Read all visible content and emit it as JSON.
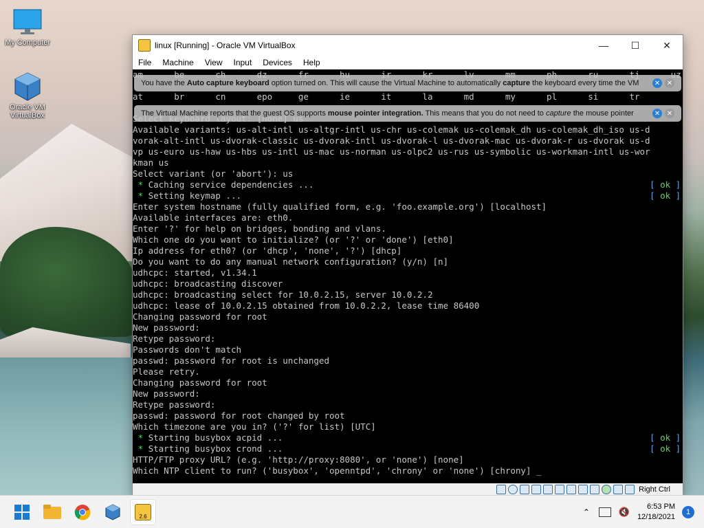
{
  "desktop": {
    "icons": [
      {
        "label": "My Computer"
      },
      {
        "label": "Oracle VM VirtualBox"
      }
    ]
  },
  "window": {
    "title": "linux [Running] - Oracle VM VirtualBox",
    "menu": [
      "File",
      "Machine",
      "View",
      "Input",
      "Devices",
      "Help"
    ],
    "banners": [
      {
        "pre": "You have the ",
        "b1": "Auto capture keyboard",
        "mid": " option turned on. This will cause the Virtual Machine to automatically ",
        "b2": "capture",
        "post": " the keyboard every time the VM"
      },
      {
        "pre": "The Virtual Machine reports that the guest OS supports ",
        "b1": "mouse pointer integration.",
        "mid": " This means that you do not need to ",
        "b2": "capture",
        "post": " the mouse pointer"
      }
    ],
    "terminal": [
      {
        "text": "am      be      ch      dz      fr      hu      ir      kr      lv      mm      ph      ru      tj      uz"
      },
      {
        "text": "                                                                                                        "
      },
      {
        "text": "at      br      cn      epo     ge      ie      it      la      md      my      pl      si      tr"
      },
      {
        "text": "                                                                                                        "
      },
      {
        "text": "Select keyboard layout: [none] us"
      },
      {
        "text": "Available variants: us-alt-intl us-altgr-intl us-chr us-colemak us-colemak_dh us-colemak_dh_iso us-d"
      },
      {
        "text": "vorak-alt-intl us-dvorak-classic us-dvorak-intl us-dvorak-l us-dvorak-mac us-dvorak-r us-dvorak us-d"
      },
      {
        "text": "vp us-euro us-haw us-hbs us-intl us-mac us-norman us-olpc2 us-rus us-symbolic us-workman-intl us-wor"
      },
      {
        "text": "kman us"
      },
      {
        "text": "Select variant (or 'abort'): us"
      },
      {
        "text": " * Caching service dependencies ...",
        "ok": true
      },
      {
        "text": " * Setting keymap ...",
        "ok": true
      },
      {
        "text": "Enter system hostname (fully qualified form, e.g. 'foo.example.org') [localhost]"
      },
      {
        "text": "Available interfaces are: eth0."
      },
      {
        "text": "Enter '?' for help on bridges, bonding and vlans."
      },
      {
        "text": "Which one do you want to initialize? (or '?' or 'done') [eth0]"
      },
      {
        "text": "Ip address for eth0? (or 'dhcp', 'none', '?') [dhcp]"
      },
      {
        "text": "Do you want to do any manual network configuration? (y/n) [n]"
      },
      {
        "text": "udhcpc: started, v1.34.1"
      },
      {
        "text": "udhcpc: broadcasting discover"
      },
      {
        "text": "udhcpc: broadcasting select for 10.0.2.15, server 10.0.2.2"
      },
      {
        "text": "udhcpc: lease of 10.0.2.15 obtained from 10.0.2.2, lease time 86400"
      },
      {
        "text": "Changing password for root"
      },
      {
        "text": "New password:"
      },
      {
        "text": "Retype password:"
      },
      {
        "text": "Passwords don't match"
      },
      {
        "text": "passwd: password for root is unchanged"
      },
      {
        "text": "Please retry."
      },
      {
        "text": "Changing password for root"
      },
      {
        "text": "New password:"
      },
      {
        "text": "Retype password:"
      },
      {
        "text": "passwd: password for root changed by root"
      },
      {
        "text": "Which timezone are you in? ('?' for list) [UTC]"
      },
      {
        "text": " * Starting busybox acpid ...",
        "ok": true
      },
      {
        "text": " * Starting busybox crond ...",
        "ok": true
      },
      {
        "text": "HTTP/FTP proxy URL? (e.g. 'http://proxy:8080', or 'none') [none]"
      },
      {
        "text": "Which NTP client to run? ('busybox', 'openntpd', 'chrony' or 'none') [chrony] _"
      }
    ],
    "ok_label": "ok",
    "status_host_key": "Right Ctrl"
  },
  "taskbar": {
    "time": "6:53 PM",
    "date": "12/18/2021",
    "notifications": "1",
    "active_app_badge": "2.6"
  }
}
